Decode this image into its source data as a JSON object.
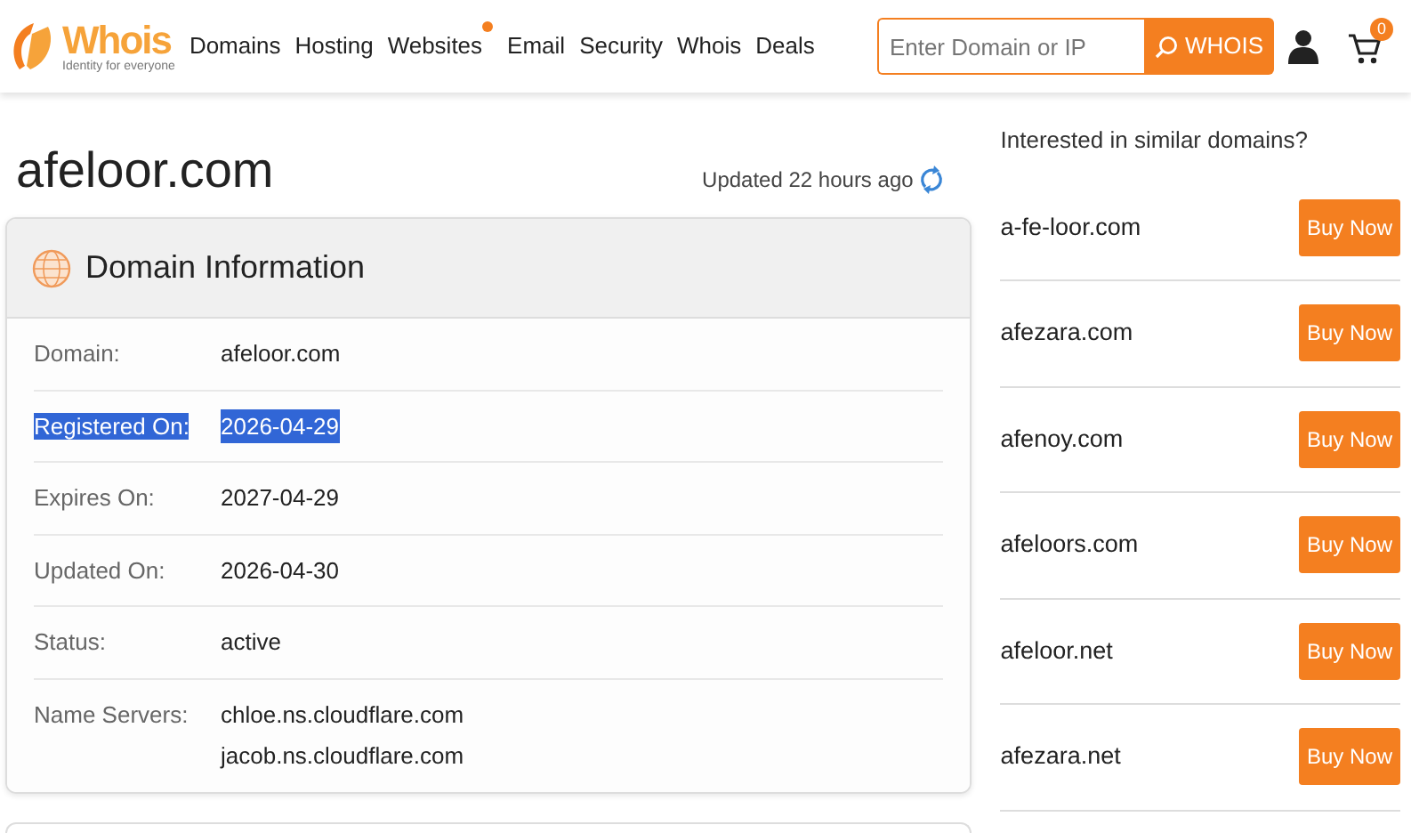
{
  "logo": {
    "name": "Whois",
    "tagline": "Identity for everyone"
  },
  "nav": [
    {
      "label": "Domains",
      "dot": false
    },
    {
      "label": "Hosting",
      "dot": false
    },
    {
      "label": "Websites",
      "dot": true
    },
    {
      "label": "Email",
      "dot": false
    },
    {
      "label": "Security",
      "dot": false
    },
    {
      "label": "Whois",
      "dot": false
    },
    {
      "label": "Deals",
      "dot": false
    }
  ],
  "search": {
    "placeholder": "Enter Domain or IP",
    "button": "WHOIS"
  },
  "cart": {
    "count": "0"
  },
  "domain_title": "afeloor.com",
  "updated": "Updated 22 hours ago",
  "info_card": {
    "title": "Domain Information",
    "rows": [
      {
        "label": "Domain:",
        "values": [
          "afeloor.com"
        ],
        "highlighted": false
      },
      {
        "label": "Registered On:",
        "values": [
          "2026-04-29"
        ],
        "highlighted": true
      },
      {
        "label": "Expires On:",
        "values": [
          "2027-04-29"
        ],
        "highlighted": false
      },
      {
        "label": "Updated On:",
        "values": [
          "2026-04-30"
        ],
        "highlighted": false
      },
      {
        "label": "Status:",
        "values": [
          "active"
        ],
        "highlighted": false
      },
      {
        "label": "Name Servers:",
        "values": [
          "chloe.ns.cloudflare.com",
          "jacob.ns.cloudflare.com"
        ],
        "highlighted": false
      }
    ]
  },
  "similar": {
    "title": "Interested in similar domains?",
    "items": [
      {
        "domain": "a-fe-loor.com",
        "button": "Buy Now"
      },
      {
        "domain": "afezara.com",
        "button": "Buy Now"
      },
      {
        "domain": "afenoy.com",
        "button": "Buy Now"
      },
      {
        "domain": "afeloors.com",
        "button": "Buy Now"
      },
      {
        "domain": "afeloor.net",
        "button": "Buy Now"
      },
      {
        "domain": "afezara.net",
        "button": "Buy Now"
      }
    ]
  }
}
